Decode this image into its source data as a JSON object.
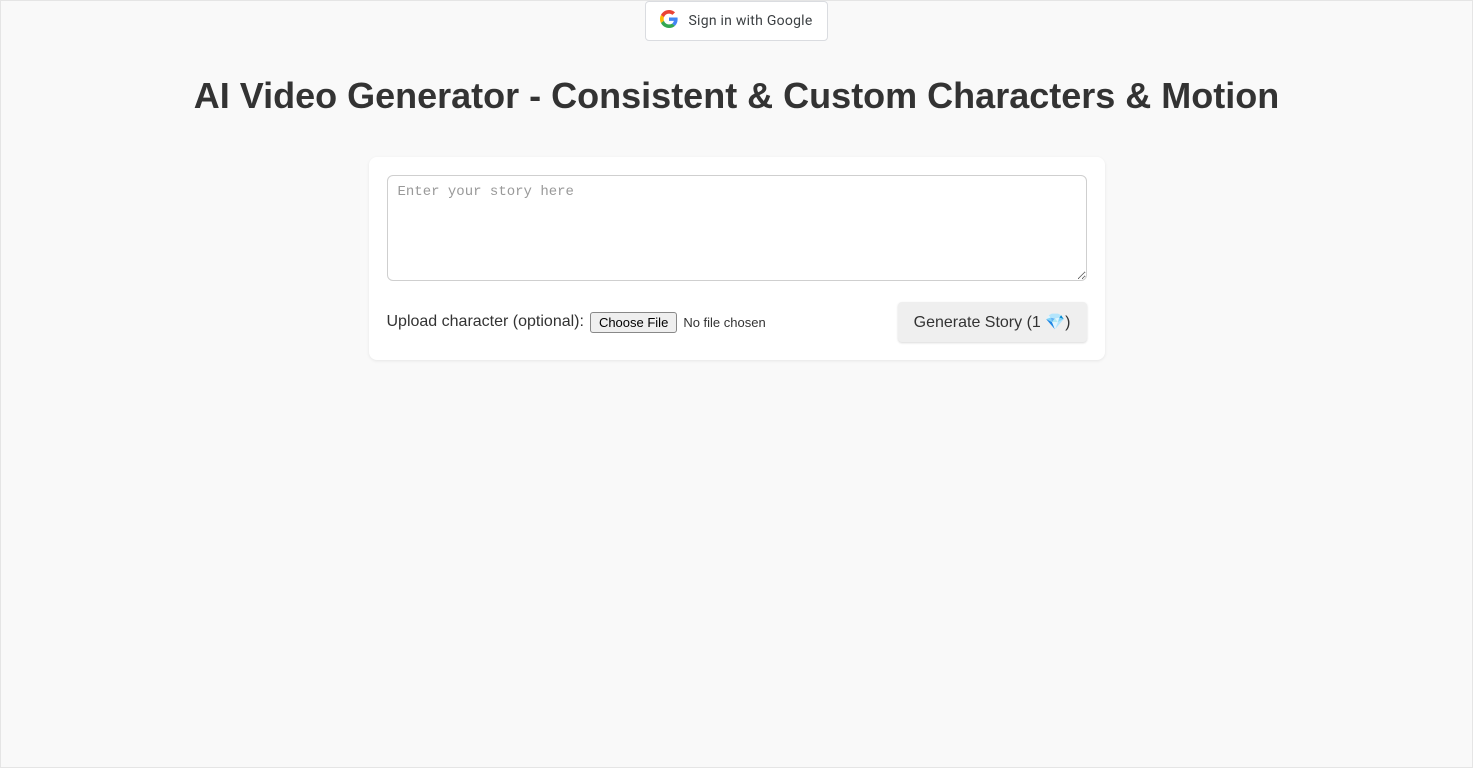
{
  "auth": {
    "google_signin_label": "Sign in with Google"
  },
  "header": {
    "title": "AI Video Generator - Consistent & Custom Characters & Motion"
  },
  "form": {
    "story_placeholder": "Enter your story here",
    "story_value": "",
    "upload_label": "Upload character (optional):",
    "choose_file_label": "Choose File",
    "file_status": "No file chosen",
    "generate_button_label": "Generate Story (1 💎)"
  }
}
